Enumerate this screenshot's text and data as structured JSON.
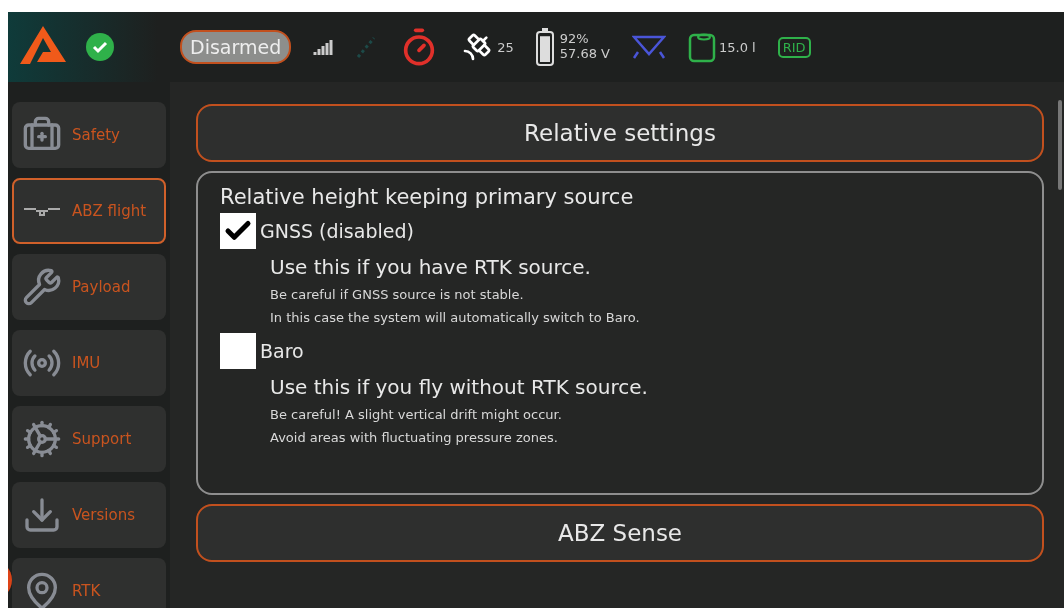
{
  "top_bar": {
    "status_ok": true,
    "arm_state": "Disarmed",
    "satellites": "25",
    "battery": {
      "percent": "92%",
      "voltage": "57.68 V",
      "level": 0.92
    },
    "tank": "15.0 l",
    "rid": "RID"
  },
  "sidebar": {
    "items": [
      {
        "label": "Safety",
        "selected": false
      },
      {
        "label": "ABZ flight",
        "selected": true
      },
      {
        "label": "Payload",
        "selected": false
      },
      {
        "label": "IMU",
        "selected": false
      },
      {
        "label": "Support",
        "selected": false
      },
      {
        "label": "Versions",
        "selected": false
      },
      {
        "label": "RTK",
        "selected": false
      }
    ]
  },
  "sections": [
    {
      "title": "Relative settings",
      "group": {
        "title": "Relative height keeping primary source",
        "options": [
          {
            "label": "GNSS (disabled)",
            "checked": true,
            "headline": "Use this if you have RTK source.",
            "notes": [
              "Be careful if GNSS source is not stable.",
              "In this case the system will automatically switch to Baro."
            ]
          },
          {
            "label": "Baro",
            "checked": false,
            "headline": "Use this if you fly without RTK source.",
            "notes": [
              "Be careful! A slight vertical drift might occur.",
              "Avoid areas with fluctuating pressure zones."
            ]
          }
        ]
      }
    },
    {
      "title": "ABZ Sense"
    }
  ]
}
